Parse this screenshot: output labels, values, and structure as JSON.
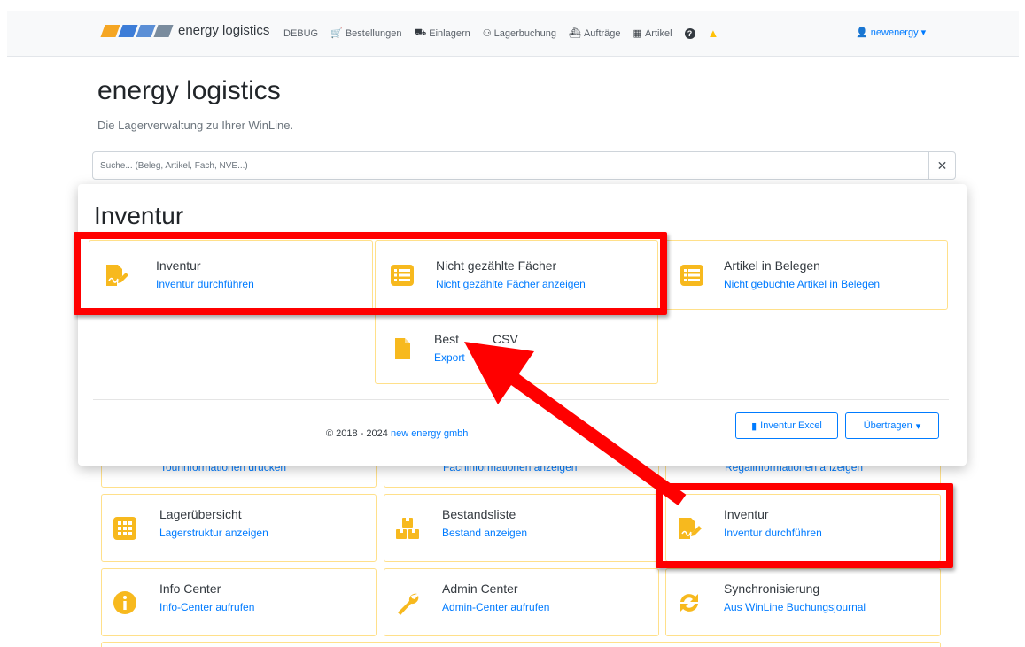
{
  "navbar": {
    "brand": "energy logistics",
    "logo_colors": [
      "#f5a623",
      "#3d7dd8",
      "#5b8fd6",
      "#7a8c9e"
    ],
    "items": [
      {
        "label": "DEBUG",
        "icon": ""
      },
      {
        "label": "Bestellungen",
        "icon": "cart-icon"
      },
      {
        "label": "Einlagern",
        "icon": "dolly-icon"
      },
      {
        "label": "Lagerbuchung",
        "icon": "people-carry-icon"
      },
      {
        "label": "Aufträge",
        "icon": "truck-loading-icon"
      },
      {
        "label": "Artikel",
        "icon": "archive-icon"
      }
    ],
    "help_icon": "question-circle-icon",
    "warning_icon": "warning-triangle-icon",
    "user": "newenergy"
  },
  "page": {
    "title": "energy logistics",
    "subtitle": "Die Lagerverwaltung zu Ihrer WinLine.",
    "search": {
      "placeholder": "Suche... (Beleg, Artikel, Fach, NVE...)",
      "value": ""
    },
    "clip_links": [
      "Tourinformationen drucken",
      "Fachinformationen anzeigen",
      "Regalinformationen anzeigen"
    ],
    "cards": [
      {
        "title": "Lagerübersicht",
        "link": "Lagerstruktur anzeigen",
        "icon": "grid-icon"
      },
      {
        "title": "Bestandsliste",
        "link": "Bestand anzeigen",
        "icon": "boxes-icon"
      },
      {
        "title": "Inventur",
        "link": "Inventur durchführen",
        "icon": "file-signature-icon"
      },
      {
        "title": "Info Center",
        "link": "Info-Center aufrufen",
        "icon": "info-circle-icon"
      },
      {
        "title": "Admin Center",
        "link": "Admin-Center aufrufen",
        "icon": "wrench-icon"
      },
      {
        "title": "Synchronisierung",
        "link": "Aus WinLine Buchungsjournal",
        "icon": "sync-icon"
      }
    ]
  },
  "modal": {
    "title": "Inventur",
    "cards": [
      {
        "title": "Inventur",
        "link": "Inventur durchführen",
        "icon": "file-signature-icon"
      },
      {
        "title": "Nicht gezählte Fächer",
        "link": "Nicht gezählte Fächer anzeigen",
        "icon": "list-icon"
      },
      {
        "title": "Artikel in Belegen",
        "link": "Nicht gebuchte Artikel in Belegen",
        "icon": "list-icon"
      },
      {
        "title": "Bestand CSV",
        "title_visible": "Best",
        "title_visible_end": "CSV",
        "link": "Export",
        "icon": "file-icon"
      }
    ],
    "footer": {
      "copyright": "© 2018 - 2024",
      "company": "new energy gmbh",
      "excel_button": "Inventur Excel",
      "transfer_button": "Übertragen"
    }
  },
  "colors": {
    "accent_yellow": "#f7b91e",
    "link_blue": "#007bff",
    "annotation_red": "#ff0000"
  }
}
